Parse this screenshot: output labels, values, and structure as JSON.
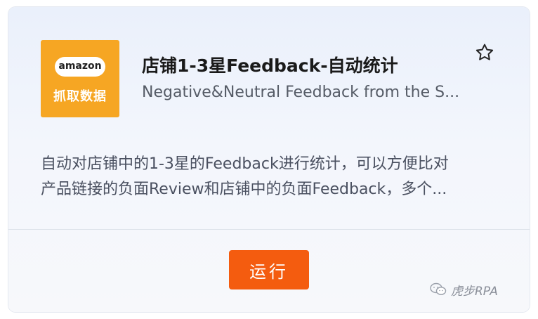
{
  "card": {
    "logo": {
      "brand": "amazon",
      "caption": "抓取数据",
      "background_color": "#f6a623"
    },
    "title": "店铺1-3星Feedback-自动统计",
    "subtitle": "Negative&Neutral Feedback from the S...",
    "favorite_icon": "star-outline-icon",
    "description": {
      "line1": "自动对店铺中的1-3星的Feedback进行统计，可以方便比对",
      "line2": "产品链接的负面Review和店铺中的负面Feedback，多个..."
    },
    "run_button": {
      "label": "运行",
      "color": "#f45c0f"
    }
  },
  "watermark": {
    "text": "虎步RPA",
    "icon": "wechat-icon"
  }
}
